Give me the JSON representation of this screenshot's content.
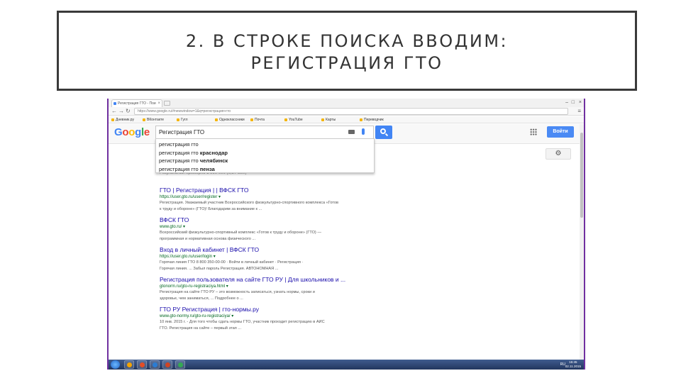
{
  "slide": {
    "title_line1": "2. В СТРОКЕ ПОИСКА ВВОДИМ:",
    "title_line2": "РЕГИСТРАЦИЯ ГТО"
  },
  "browser": {
    "tab_title": "Регистрация ГТО - Пои",
    "tab_close": "×",
    "url": "https://www.google.ru/#newwindow=1&q=регистрация+гто",
    "bookmarks": [
      "Дневник.ру",
      "ВКонтакте",
      "Гугл",
      "Одноклассники",
      "Почта",
      "YouTube",
      "Карты",
      "Переводчик"
    ]
  },
  "google": {
    "logo": "Google",
    "colors": {
      "blue": "#4285f4",
      "red": "#ea4335",
      "yellow": "#fbbc05",
      "green": "#34a853"
    },
    "query": "Регистрация ГТО",
    "signin_label": "Войти",
    "gear_label": "⚙",
    "suggestions": [
      {
        "base": "регистрация гто",
        "extra": ""
      },
      {
        "base": "регистрация гто ",
        "extra": "краснодар"
      },
      {
        "base": "регистрация гто ",
        "extra": "челябинск"
      },
      {
        "base": "регистрация гто ",
        "extra": "пенза"
      }
    ],
    "stats": "Результатов: примерно 1 990 000 (0,37 сек.)",
    "results": [
      {
        "title": "ГТО | Регистрация | | ВФСК ГТО",
        "url": "https://user.gto.ru/user/register ▾",
        "snippet1": "Регистрация. Уважаемый участник Всероссийского физкультурно-спортивного комплекса «Готов",
        "snippet2": "к труду и обороне» (ГТО)! Благодарим за внимание к ..."
      },
      {
        "title": "ВФСК ГТО",
        "url": "www.gto.ru/ ▾",
        "snippet1": "Всероссийский физкультурно-спортивный комплекс «Готов к труду и обороне» (ГТО) —",
        "snippet2": "программная и нормативная основа физического ..."
      },
      {
        "title": "Вход в личный кабинет | ВФСК ГТО",
        "url": "https://user.gto.ru/user/login ▾",
        "snippet1": "Горячая линия ГТО 8 800 350-00-00 · Войти в личный кабинет · Регистрация ·",
        "snippet2": "Горячая линия. ... Забыл пароль Регистрация. АВТОНОМНАЯ ..."
      },
      {
        "title": "Регистрация пользователя на сайте ГТО РУ | Для школьников и ...",
        "url": "gtonorm.ru/gto-ru-registraciya.html ▾",
        "snippet1": "Регистрация на сайте ГТО РУ – это возможность записаться, узнать нормы, сроки и",
        "snippet2": "здоровье, чем заниматься, ... Подробнее о ..."
      },
      {
        "title": "ГТО РУ Регистрация | гто-нормы.ру",
        "url": "www.gto-normy.ru/gto-ru-registraciya/ ▾",
        "snippet1": "10 янв. 2015 г. - Для того чтобы сдать нормы ГТО, участник проходит регистрацию в АИС",
        "snippet2": "ГТО. Регистрация на сайте – первый этап ..."
      }
    ]
  },
  "taskbar": {
    "lang": "RU",
    "time": "15:45",
    "date": "02.11.2015",
    "app_colors": [
      "#f4a300",
      "#e44d26",
      "#2b7cd3",
      "#d04423",
      "#34a853"
    ]
  }
}
